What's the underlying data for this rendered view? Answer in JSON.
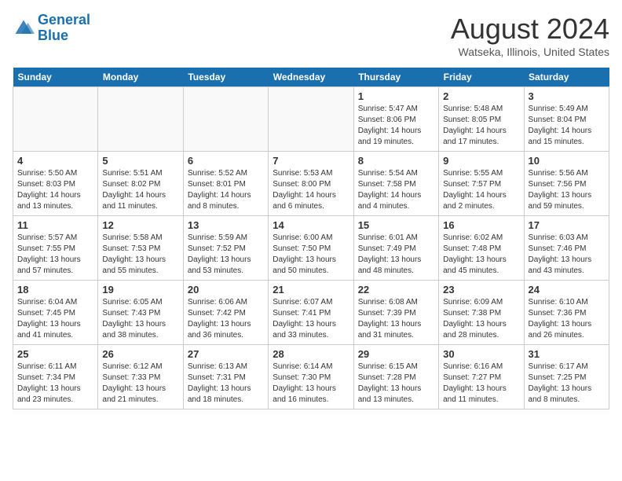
{
  "header": {
    "logo_line1": "General",
    "logo_line2": "Blue",
    "month_year": "August 2024",
    "location": "Watseka, Illinois, United States"
  },
  "days_of_week": [
    "Sunday",
    "Monday",
    "Tuesday",
    "Wednesday",
    "Thursday",
    "Friday",
    "Saturday"
  ],
  "weeks": [
    [
      {
        "date": "",
        "sunrise": "",
        "sunset": "",
        "daylight": ""
      },
      {
        "date": "",
        "sunrise": "",
        "sunset": "",
        "daylight": ""
      },
      {
        "date": "",
        "sunrise": "",
        "sunset": "",
        "daylight": ""
      },
      {
        "date": "",
        "sunrise": "",
        "sunset": "",
        "daylight": ""
      },
      {
        "date": "1",
        "sunrise": "Sunrise: 5:47 AM",
        "sunset": "Sunset: 8:06 PM",
        "daylight": "Daylight: 14 hours and 19 minutes."
      },
      {
        "date": "2",
        "sunrise": "Sunrise: 5:48 AM",
        "sunset": "Sunset: 8:05 PM",
        "daylight": "Daylight: 14 hours and 17 minutes."
      },
      {
        "date": "3",
        "sunrise": "Sunrise: 5:49 AM",
        "sunset": "Sunset: 8:04 PM",
        "daylight": "Daylight: 14 hours and 15 minutes."
      }
    ],
    [
      {
        "date": "4",
        "sunrise": "Sunrise: 5:50 AM",
        "sunset": "Sunset: 8:03 PM",
        "daylight": "Daylight: 14 hours and 13 minutes."
      },
      {
        "date": "5",
        "sunrise": "Sunrise: 5:51 AM",
        "sunset": "Sunset: 8:02 PM",
        "daylight": "Daylight: 14 hours and 11 minutes."
      },
      {
        "date": "6",
        "sunrise": "Sunrise: 5:52 AM",
        "sunset": "Sunset: 8:01 PM",
        "daylight": "Daylight: 14 hours and 8 minutes."
      },
      {
        "date": "7",
        "sunrise": "Sunrise: 5:53 AM",
        "sunset": "Sunset: 8:00 PM",
        "daylight": "Daylight: 14 hours and 6 minutes."
      },
      {
        "date": "8",
        "sunrise": "Sunrise: 5:54 AM",
        "sunset": "Sunset: 7:58 PM",
        "daylight": "Daylight: 14 hours and 4 minutes."
      },
      {
        "date": "9",
        "sunrise": "Sunrise: 5:55 AM",
        "sunset": "Sunset: 7:57 PM",
        "daylight": "Daylight: 14 hours and 2 minutes."
      },
      {
        "date": "10",
        "sunrise": "Sunrise: 5:56 AM",
        "sunset": "Sunset: 7:56 PM",
        "daylight": "Daylight: 13 hours and 59 minutes."
      }
    ],
    [
      {
        "date": "11",
        "sunrise": "Sunrise: 5:57 AM",
        "sunset": "Sunset: 7:55 PM",
        "daylight": "Daylight: 13 hours and 57 minutes."
      },
      {
        "date": "12",
        "sunrise": "Sunrise: 5:58 AM",
        "sunset": "Sunset: 7:53 PM",
        "daylight": "Daylight: 13 hours and 55 minutes."
      },
      {
        "date": "13",
        "sunrise": "Sunrise: 5:59 AM",
        "sunset": "Sunset: 7:52 PM",
        "daylight": "Daylight: 13 hours and 53 minutes."
      },
      {
        "date": "14",
        "sunrise": "Sunrise: 6:00 AM",
        "sunset": "Sunset: 7:50 PM",
        "daylight": "Daylight: 13 hours and 50 minutes."
      },
      {
        "date": "15",
        "sunrise": "Sunrise: 6:01 AM",
        "sunset": "Sunset: 7:49 PM",
        "daylight": "Daylight: 13 hours and 48 minutes."
      },
      {
        "date": "16",
        "sunrise": "Sunrise: 6:02 AM",
        "sunset": "Sunset: 7:48 PM",
        "daylight": "Daylight: 13 hours and 45 minutes."
      },
      {
        "date": "17",
        "sunrise": "Sunrise: 6:03 AM",
        "sunset": "Sunset: 7:46 PM",
        "daylight": "Daylight: 13 hours and 43 minutes."
      }
    ],
    [
      {
        "date": "18",
        "sunrise": "Sunrise: 6:04 AM",
        "sunset": "Sunset: 7:45 PM",
        "daylight": "Daylight: 13 hours and 41 minutes."
      },
      {
        "date": "19",
        "sunrise": "Sunrise: 6:05 AM",
        "sunset": "Sunset: 7:43 PM",
        "daylight": "Daylight: 13 hours and 38 minutes."
      },
      {
        "date": "20",
        "sunrise": "Sunrise: 6:06 AM",
        "sunset": "Sunset: 7:42 PM",
        "daylight": "Daylight: 13 hours and 36 minutes."
      },
      {
        "date": "21",
        "sunrise": "Sunrise: 6:07 AM",
        "sunset": "Sunset: 7:41 PM",
        "daylight": "Daylight: 13 hours and 33 minutes."
      },
      {
        "date": "22",
        "sunrise": "Sunrise: 6:08 AM",
        "sunset": "Sunset: 7:39 PM",
        "daylight": "Daylight: 13 hours and 31 minutes."
      },
      {
        "date": "23",
        "sunrise": "Sunrise: 6:09 AM",
        "sunset": "Sunset: 7:38 PM",
        "daylight": "Daylight: 13 hours and 28 minutes."
      },
      {
        "date": "24",
        "sunrise": "Sunrise: 6:10 AM",
        "sunset": "Sunset: 7:36 PM",
        "daylight": "Daylight: 13 hours and 26 minutes."
      }
    ],
    [
      {
        "date": "25",
        "sunrise": "Sunrise: 6:11 AM",
        "sunset": "Sunset: 7:34 PM",
        "daylight": "Daylight: 13 hours and 23 minutes."
      },
      {
        "date": "26",
        "sunrise": "Sunrise: 6:12 AM",
        "sunset": "Sunset: 7:33 PM",
        "daylight": "Daylight: 13 hours and 21 minutes."
      },
      {
        "date": "27",
        "sunrise": "Sunrise: 6:13 AM",
        "sunset": "Sunset: 7:31 PM",
        "daylight": "Daylight: 13 hours and 18 minutes."
      },
      {
        "date": "28",
        "sunrise": "Sunrise: 6:14 AM",
        "sunset": "Sunset: 7:30 PM",
        "daylight": "Daylight: 13 hours and 16 minutes."
      },
      {
        "date": "29",
        "sunrise": "Sunrise: 6:15 AM",
        "sunset": "Sunset: 7:28 PM",
        "daylight": "Daylight: 13 hours and 13 minutes."
      },
      {
        "date": "30",
        "sunrise": "Sunrise: 6:16 AM",
        "sunset": "Sunset: 7:27 PM",
        "daylight": "Daylight: 13 hours and 11 minutes."
      },
      {
        "date": "31",
        "sunrise": "Sunrise: 6:17 AM",
        "sunset": "Sunset: 7:25 PM",
        "daylight": "Daylight: 13 hours and 8 minutes."
      }
    ]
  ]
}
